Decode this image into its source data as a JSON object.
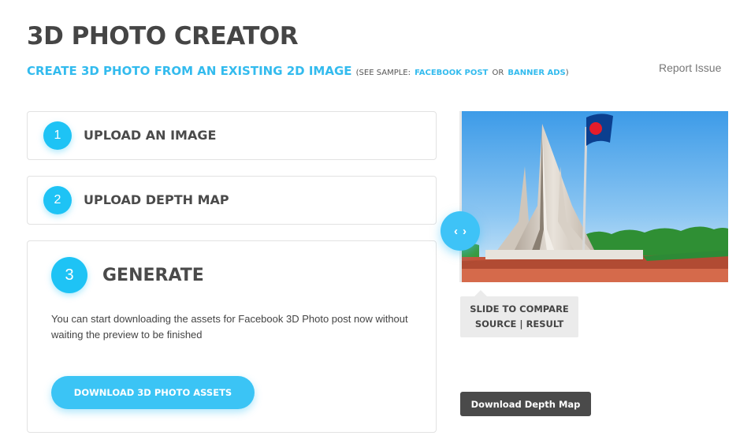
{
  "header": {
    "title": "3D PHOTO CREATOR",
    "subtitle": "CREATE 3D PHOTO FROM AN EXISTING 2D IMAGE",
    "sample_prefix": "(SEE SAMPLE:",
    "sample_link_1": "FACEBOOK POST",
    "sample_or": "OR",
    "sample_link_2": "BANNER ADS",
    "sample_suffix": ")",
    "report_issue": "Report Issue"
  },
  "steps": [
    {
      "number": "1",
      "label": "UPLOAD AN IMAGE"
    },
    {
      "number": "2",
      "label": "UPLOAD DEPTH MAP"
    },
    {
      "number": "3",
      "label": "GENERATE"
    }
  ],
  "generate": {
    "description": "You can start downloading the assets for Facebook 3D Photo post now without waiting the preview to be finished",
    "download_button": "DOWNLOAD 3D PHOTO ASSETS"
  },
  "preview": {
    "handle_left": "‹",
    "handle_right": "›",
    "tooltip_line1": "SLIDE TO COMPARE",
    "tooltip_line2": "SOURCE | RESULT",
    "download_depth_button": "Download Depth Map"
  },
  "colors": {
    "accent": "#1ec3f5",
    "title": "#454545",
    "dark_button": "#4a4a4a"
  }
}
